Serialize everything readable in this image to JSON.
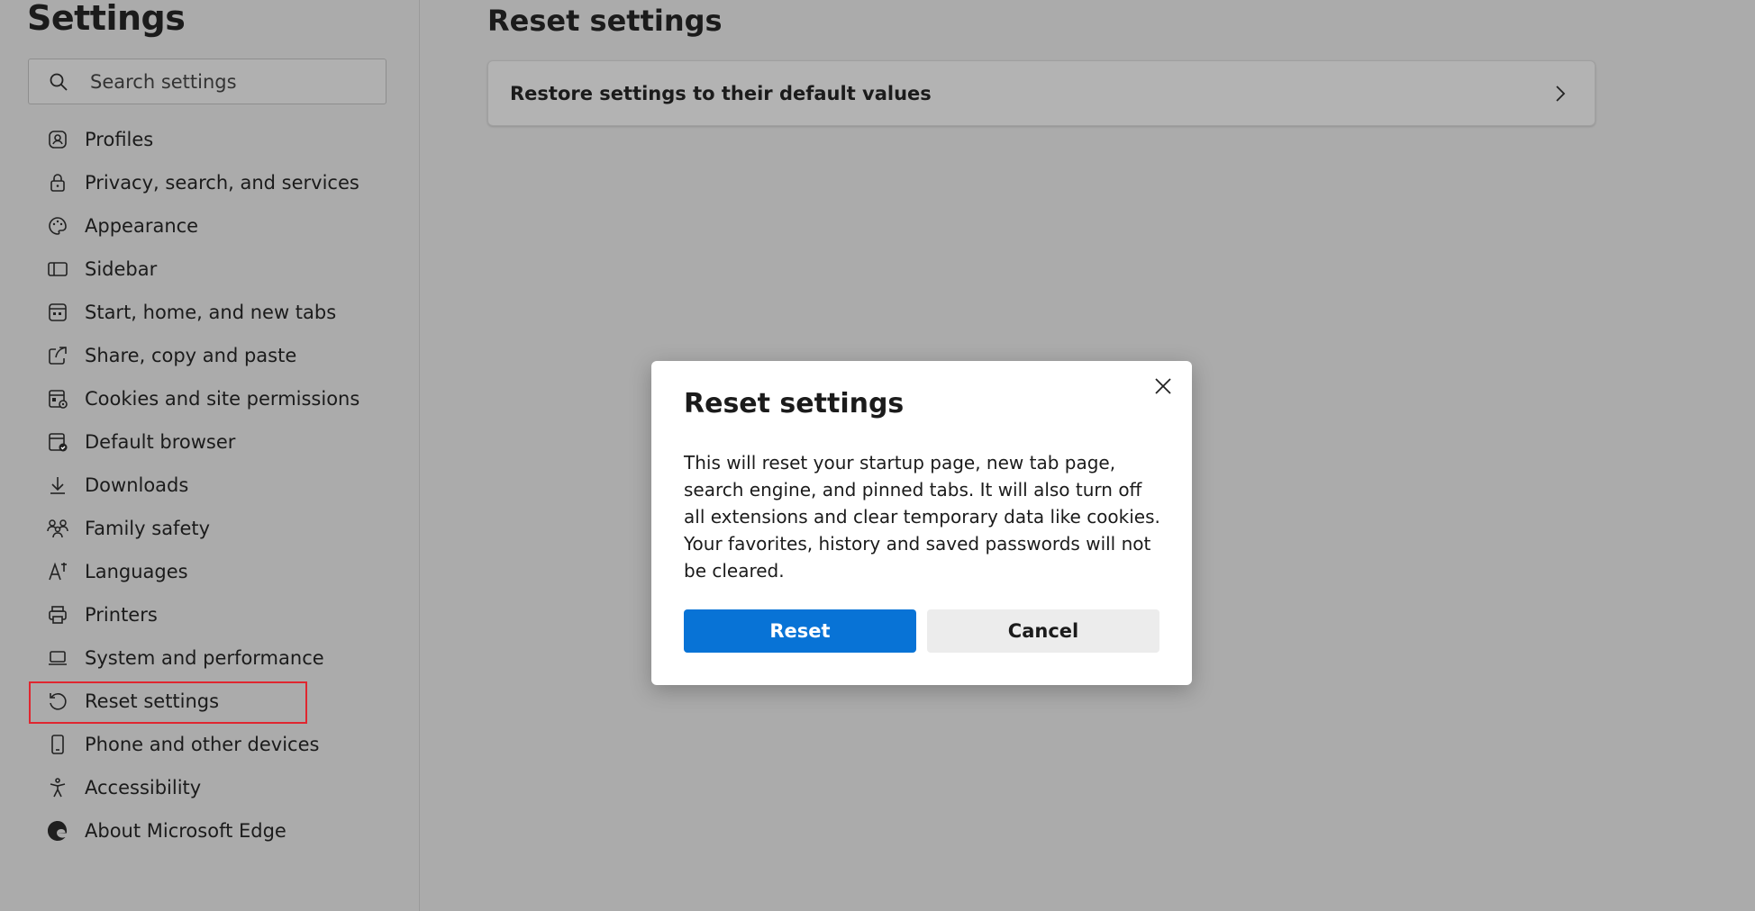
{
  "sidebar": {
    "title": "Settings",
    "search_placeholder": "Search settings",
    "items": [
      {
        "label": "Profiles",
        "icon": "profile-icon"
      },
      {
        "label": "Privacy, search, and services",
        "icon": "lock-icon"
      },
      {
        "label": "Appearance",
        "icon": "palette-icon"
      },
      {
        "label": "Sidebar",
        "icon": "sidebar-icon"
      },
      {
        "label": "Start, home, and new tabs",
        "icon": "home-grid-icon"
      },
      {
        "label": "Share, copy and paste",
        "icon": "share-icon"
      },
      {
        "label": "Cookies and site permissions",
        "icon": "cookie-icon"
      },
      {
        "label": "Default browser",
        "icon": "browser-icon"
      },
      {
        "label": "Downloads",
        "icon": "download-icon"
      },
      {
        "label": "Family safety",
        "icon": "family-icon"
      },
      {
        "label": "Languages",
        "icon": "language-icon"
      },
      {
        "label": "Printers",
        "icon": "printer-icon"
      },
      {
        "label": "System and performance",
        "icon": "laptop-icon"
      },
      {
        "label": "Reset settings",
        "icon": "reset-icon"
      },
      {
        "label": "Phone and other devices",
        "icon": "phone-icon"
      },
      {
        "label": "Accessibility",
        "icon": "accessibility-icon"
      },
      {
        "label": "About Microsoft Edge",
        "icon": "edge-logo-icon"
      }
    ],
    "selected_index": 13
  },
  "main": {
    "title": "Reset settings",
    "card_label": "Restore settings to their default values"
  },
  "dialog": {
    "title": "Reset settings",
    "body": "This will reset your startup page, new tab page, search engine, and pinned tabs. It will also turn off all extensions and clear temporary data like cookies. Your favorites, history and saved passwords will not be cleared.",
    "reset_label": "Reset",
    "cancel_label": "Cancel"
  },
  "colors": {
    "overlay_background": "#ababab",
    "primary_button": "#0873d6",
    "highlight_border": "#e0262f"
  }
}
